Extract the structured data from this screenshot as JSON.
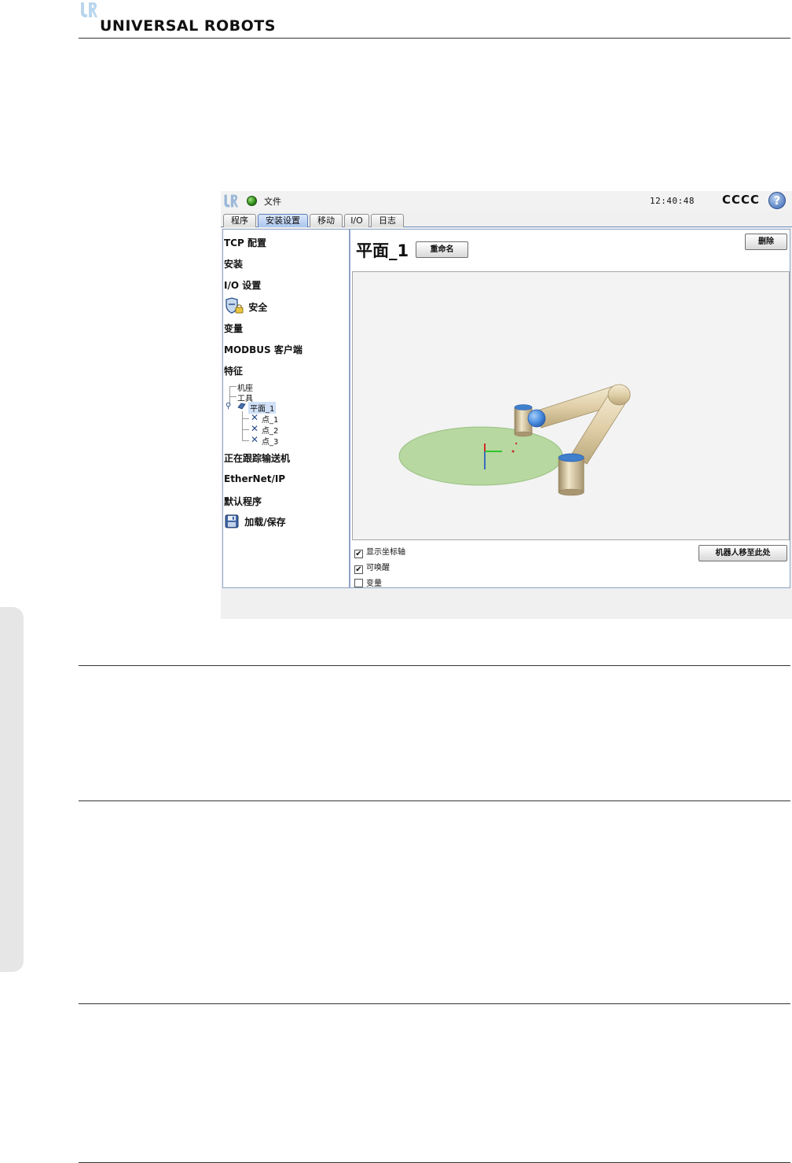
{
  "brand": {
    "name": "UNIVERSAL ROBOTS"
  },
  "titlebar": {
    "file_menu": "文件",
    "time": "12:40:48",
    "robot_name": "CCCC",
    "help": "?"
  },
  "tabs": [
    {
      "label": "程序",
      "active": false
    },
    {
      "label": "安装设置",
      "active": true
    },
    {
      "label": "移动",
      "active": false
    },
    {
      "label": "I/O",
      "active": false
    },
    {
      "label": "日志",
      "active": false
    }
  ],
  "sidebar": {
    "items": [
      {
        "label": "TCP 配置"
      },
      {
        "label": "安装"
      },
      {
        "label": "I/O 设置"
      },
      {
        "label": "安全",
        "icon": "shield-lock-icon"
      },
      {
        "label": "变量"
      },
      {
        "label": "MODBUS 客户端"
      },
      {
        "label": "特征"
      },
      {
        "label": "正在跟踪输送机"
      },
      {
        "label": "EtherNet/IP"
      },
      {
        "label": "默认程序"
      },
      {
        "label": "加载/保存",
        "icon": "floppy-disk-icon"
      }
    ],
    "features_tree": {
      "base": "机座",
      "tool": "工具",
      "plane": "平面_1",
      "points": [
        "点_1",
        "点_2",
        "点_3"
      ]
    }
  },
  "main": {
    "title": "平面_1",
    "rename_button": "重命名",
    "delete_button": "删除",
    "checkboxes": [
      {
        "label": "显示坐标轴",
        "checked": true
      },
      {
        "label": "可唤醒",
        "checked": true
      },
      {
        "label": "变量",
        "checked": false
      }
    ],
    "move_here_button": "机器人移至此处"
  },
  "colors": {
    "plane_fill": "#b7d8a0",
    "robot_body": "#e4d5b2",
    "robot_joint": "#4a8ee0",
    "tab_active": "#a9c4ee",
    "status_ok": "#2a8a14"
  }
}
